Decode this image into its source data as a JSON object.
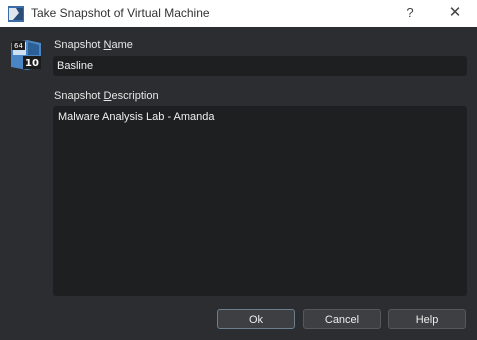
{
  "window": {
    "title": "Take Snapshot of Virtual Machine",
    "help_glyph": "?",
    "close_glyph": "✕"
  },
  "vm_icon": {
    "badge_top": "64",
    "badge_bottom": "10"
  },
  "snapshot_name": {
    "label_pre": "Snapshot ",
    "label_mnemonic": "N",
    "label_post": "ame",
    "value": "Basline"
  },
  "snapshot_description": {
    "label_pre": "Snapshot ",
    "label_mnemonic": "D",
    "label_post": "escription",
    "value": "Malware Analysis Lab - Amanda"
  },
  "buttons": {
    "ok": "Ok",
    "cancel": "Cancel",
    "help": "Help"
  }
}
